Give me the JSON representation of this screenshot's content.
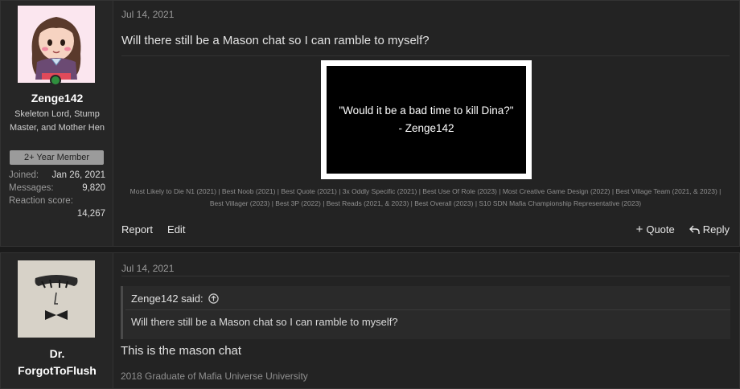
{
  "post1": {
    "user": {
      "name": "Zenge142",
      "title": "Skeleton Lord, Stump Master, and Mother Hen",
      "badge": "2+ Year Member",
      "joined_label": "Joined:",
      "joined_value": "Jan 26, 2021",
      "messages_label": "Messages:",
      "messages_value": "9,820",
      "reaction_label": "Reaction score:",
      "reaction_value": "14,267",
      "online_status": "online"
    },
    "date": "Jul 14, 2021",
    "text": "Will there still be a Mason chat so I can ramble to myself?",
    "image_quote_line1": "\"Would it be a bad time to kill Dina?\"",
    "image_quote_line2": "- Zenge142",
    "signature_line1": "Most Likely to Die N1 (2021) | Best Noob (2021) | Best Quote (2021) | 3x Oddly Specific (2021) | Best Use Of Role (2023) | Most Creative Game Design (2022) | Best Village Team (2021, & 2023) |",
    "signature_line2": "Best Villager (2023) | Best 3P (2022) | Best Reads (2021, & 2023) | Best Overall (2023) | S10 SDN Mafia Championship Representative (2023)",
    "actions": {
      "report": "Report",
      "edit": "Edit",
      "quote": "Quote",
      "reply": "Reply"
    }
  },
  "post2": {
    "user": {
      "name_line1": "Dr.",
      "name_line2": "ForgotToFlush"
    },
    "date": "Jul 14, 2021",
    "quote_author": "Zenge142 said:",
    "quote_text": "Will there still be a Mason chat so I can ramble to myself?",
    "text": "This is the mason chat",
    "signature": "2018 Graduate of Mafia Universe University"
  },
  "colors": {
    "background": "#1b1b1b",
    "panel": "#232323",
    "online": "#2f8f3e",
    "badge": "#9b9b9b"
  }
}
